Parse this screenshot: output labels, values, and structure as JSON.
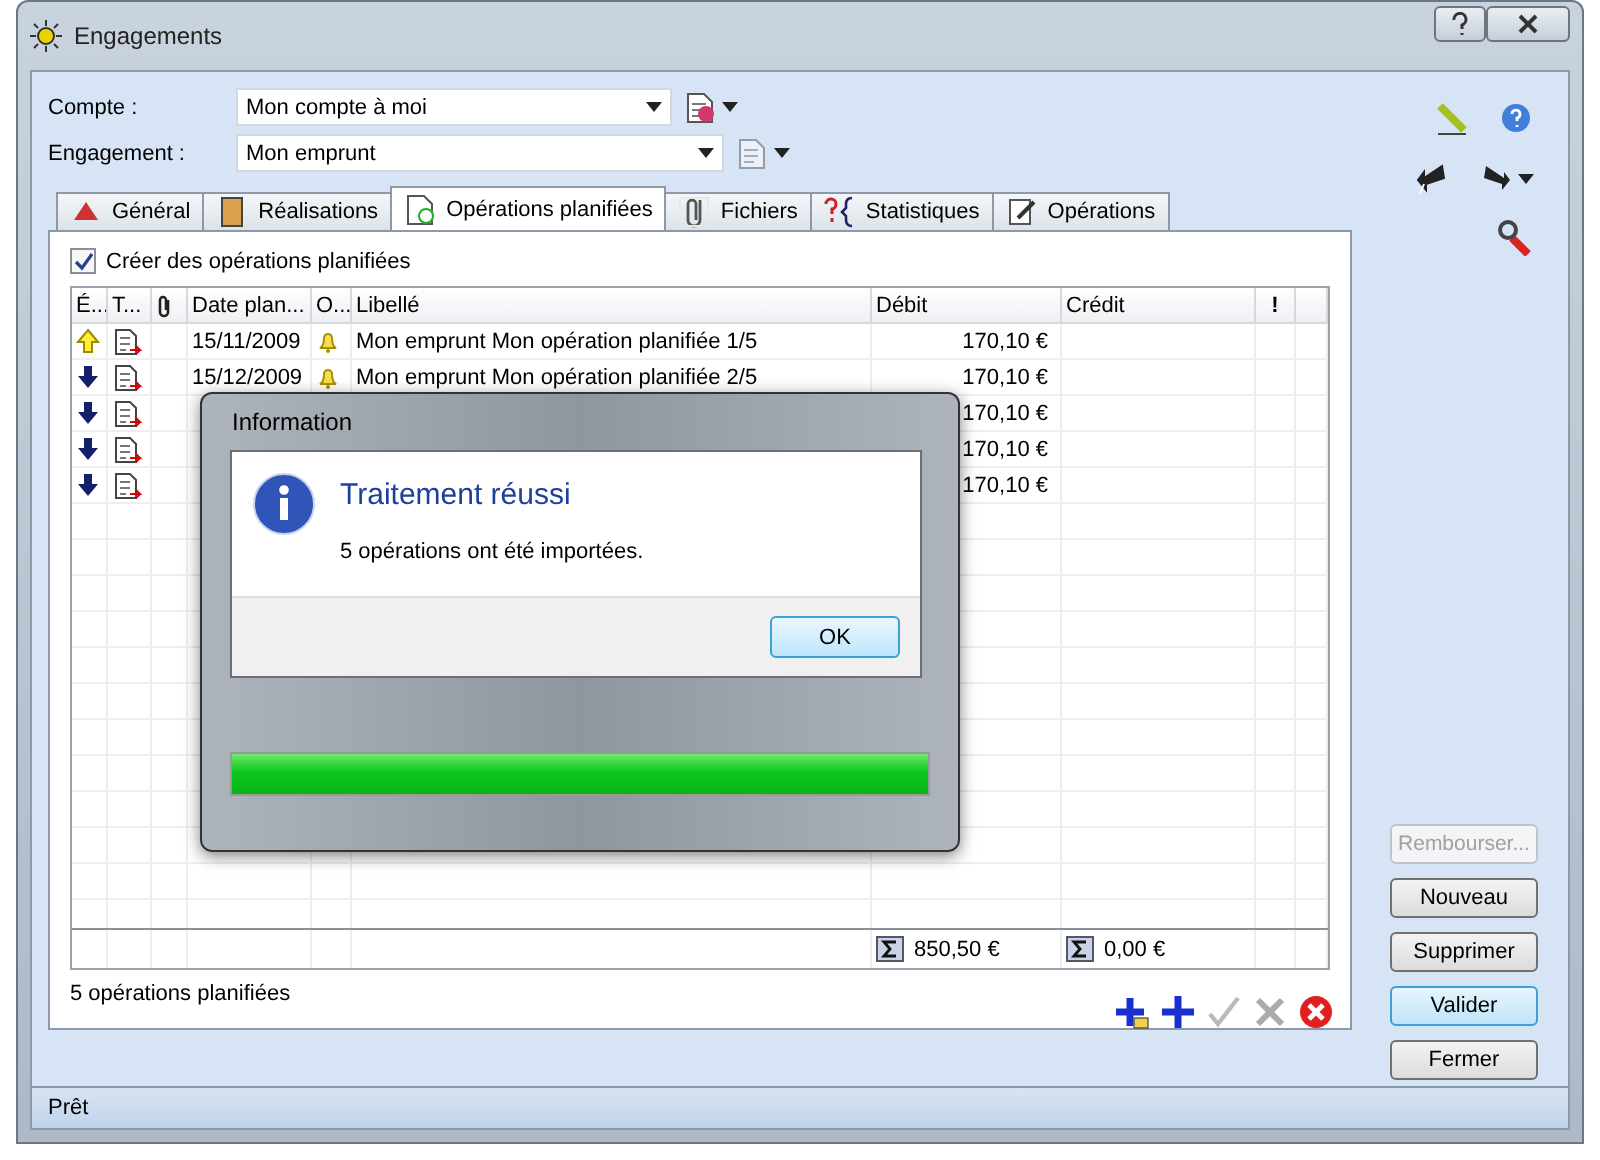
{
  "window": {
    "title": "Engagements"
  },
  "fields": [
    {
      "label": "Compte :",
      "value": "Mon compte à moi",
      "icon_disabled": false
    },
    {
      "label": "Engagement :",
      "value": "Mon emprunt",
      "icon_disabled": true
    }
  ],
  "tabs": [
    {
      "label": "Général",
      "selected": false
    },
    {
      "label": "Réalisations",
      "selected": false
    },
    {
      "label": "Opérations planifiées",
      "selected": true
    },
    {
      "label": "Fichiers",
      "selected": false
    },
    {
      "label": "Statistiques",
      "selected": false
    },
    {
      "label": "Opérations",
      "selected": false
    }
  ],
  "create_checkbox": {
    "label": "Créer des opérations planifiées",
    "checked": true
  },
  "table": {
    "columns": [
      "É...",
      "T...",
      "",
      "Date plan...",
      "O...",
      "Libellé",
      "Débit",
      "Crédit",
      "!"
    ],
    "rows": [
      {
        "kind": "up",
        "date": "15/11/2009",
        "libelle": "Mon emprunt Mon opération planifiée 1/5",
        "debit": "170,10 €"
      },
      {
        "kind": "down",
        "date": "15/12/2009",
        "libelle": "Mon emprunt Mon opération planifiée 2/5",
        "debit": "170,10 €"
      },
      {
        "kind": "down",
        "debit": "170,10 €"
      },
      {
        "kind": "down",
        "debit": "170,10 €"
      },
      {
        "kind": "down",
        "debit": "170,10 €"
      }
    ],
    "totals": {
      "debit": "850,50 €",
      "credit": "0,00 €"
    }
  },
  "count_label": "5 opérations planifiées",
  "side_buttons": [
    {
      "label": "Rembourser...",
      "disabled": true,
      "selected": false
    },
    {
      "label": "Nouveau",
      "disabled": false,
      "selected": false
    },
    {
      "label": "Supprimer",
      "disabled": false,
      "selected": false
    },
    {
      "label": "Valider",
      "disabled": false,
      "selected": true
    },
    {
      "label": "Fermer",
      "disabled": false,
      "selected": false
    }
  ],
  "status_bar": "Prêt",
  "dialog": {
    "title": "Information",
    "heading": "Traitement réussi",
    "message": "5 opérations ont été importées.",
    "button": "OK",
    "progress": {
      "level": 1
    }
  }
}
